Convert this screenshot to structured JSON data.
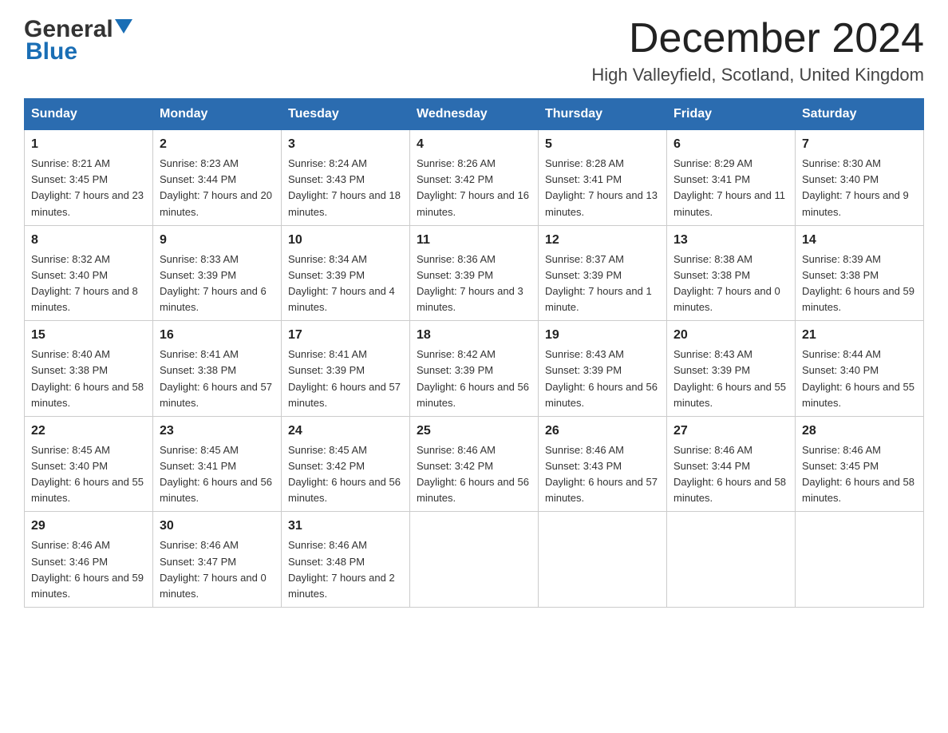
{
  "header": {
    "logo_general": "General",
    "logo_blue": "Blue",
    "month": "December 2024",
    "location": "High Valleyfield, Scotland, United Kingdom"
  },
  "days_of_week": [
    "Sunday",
    "Monday",
    "Tuesday",
    "Wednesday",
    "Thursday",
    "Friday",
    "Saturday"
  ],
  "weeks": [
    [
      {
        "day": "1",
        "sunrise": "8:21 AM",
        "sunset": "3:45 PM",
        "daylight": "7 hours and 23 minutes."
      },
      {
        "day": "2",
        "sunrise": "8:23 AM",
        "sunset": "3:44 PM",
        "daylight": "7 hours and 20 minutes."
      },
      {
        "day": "3",
        "sunrise": "8:24 AM",
        "sunset": "3:43 PM",
        "daylight": "7 hours and 18 minutes."
      },
      {
        "day": "4",
        "sunrise": "8:26 AM",
        "sunset": "3:42 PM",
        "daylight": "7 hours and 16 minutes."
      },
      {
        "day": "5",
        "sunrise": "8:28 AM",
        "sunset": "3:41 PM",
        "daylight": "7 hours and 13 minutes."
      },
      {
        "day": "6",
        "sunrise": "8:29 AM",
        "sunset": "3:41 PM",
        "daylight": "7 hours and 11 minutes."
      },
      {
        "day": "7",
        "sunrise": "8:30 AM",
        "sunset": "3:40 PM",
        "daylight": "7 hours and 9 minutes."
      }
    ],
    [
      {
        "day": "8",
        "sunrise": "8:32 AM",
        "sunset": "3:40 PM",
        "daylight": "7 hours and 8 minutes."
      },
      {
        "day": "9",
        "sunrise": "8:33 AM",
        "sunset": "3:39 PM",
        "daylight": "7 hours and 6 minutes."
      },
      {
        "day": "10",
        "sunrise": "8:34 AM",
        "sunset": "3:39 PM",
        "daylight": "7 hours and 4 minutes."
      },
      {
        "day": "11",
        "sunrise": "8:36 AM",
        "sunset": "3:39 PM",
        "daylight": "7 hours and 3 minutes."
      },
      {
        "day": "12",
        "sunrise": "8:37 AM",
        "sunset": "3:39 PM",
        "daylight": "7 hours and 1 minute."
      },
      {
        "day": "13",
        "sunrise": "8:38 AM",
        "sunset": "3:38 PM",
        "daylight": "7 hours and 0 minutes."
      },
      {
        "day": "14",
        "sunrise": "8:39 AM",
        "sunset": "3:38 PM",
        "daylight": "6 hours and 59 minutes."
      }
    ],
    [
      {
        "day": "15",
        "sunrise": "8:40 AM",
        "sunset": "3:38 PM",
        "daylight": "6 hours and 58 minutes."
      },
      {
        "day": "16",
        "sunrise": "8:41 AM",
        "sunset": "3:38 PM",
        "daylight": "6 hours and 57 minutes."
      },
      {
        "day": "17",
        "sunrise": "8:41 AM",
        "sunset": "3:39 PM",
        "daylight": "6 hours and 57 minutes."
      },
      {
        "day": "18",
        "sunrise": "8:42 AM",
        "sunset": "3:39 PM",
        "daylight": "6 hours and 56 minutes."
      },
      {
        "day": "19",
        "sunrise": "8:43 AM",
        "sunset": "3:39 PM",
        "daylight": "6 hours and 56 minutes."
      },
      {
        "day": "20",
        "sunrise": "8:43 AM",
        "sunset": "3:39 PM",
        "daylight": "6 hours and 55 minutes."
      },
      {
        "day": "21",
        "sunrise": "8:44 AM",
        "sunset": "3:40 PM",
        "daylight": "6 hours and 55 minutes."
      }
    ],
    [
      {
        "day": "22",
        "sunrise": "8:45 AM",
        "sunset": "3:40 PM",
        "daylight": "6 hours and 55 minutes."
      },
      {
        "day": "23",
        "sunrise": "8:45 AM",
        "sunset": "3:41 PM",
        "daylight": "6 hours and 56 minutes."
      },
      {
        "day": "24",
        "sunrise": "8:45 AM",
        "sunset": "3:42 PM",
        "daylight": "6 hours and 56 minutes."
      },
      {
        "day": "25",
        "sunrise": "8:46 AM",
        "sunset": "3:42 PM",
        "daylight": "6 hours and 56 minutes."
      },
      {
        "day": "26",
        "sunrise": "8:46 AM",
        "sunset": "3:43 PM",
        "daylight": "6 hours and 57 minutes."
      },
      {
        "day": "27",
        "sunrise": "8:46 AM",
        "sunset": "3:44 PM",
        "daylight": "6 hours and 58 minutes."
      },
      {
        "day": "28",
        "sunrise": "8:46 AM",
        "sunset": "3:45 PM",
        "daylight": "6 hours and 58 minutes."
      }
    ],
    [
      {
        "day": "29",
        "sunrise": "8:46 AM",
        "sunset": "3:46 PM",
        "daylight": "6 hours and 59 minutes."
      },
      {
        "day": "30",
        "sunrise": "8:46 AM",
        "sunset": "3:47 PM",
        "daylight": "7 hours and 0 minutes."
      },
      {
        "day": "31",
        "sunrise": "8:46 AM",
        "sunset": "3:48 PM",
        "daylight": "7 hours and 2 minutes."
      },
      null,
      null,
      null,
      null
    ]
  ],
  "labels": {
    "sunrise_prefix": "Sunrise: ",
    "sunset_prefix": "Sunset: ",
    "daylight_prefix": "Daylight: "
  }
}
